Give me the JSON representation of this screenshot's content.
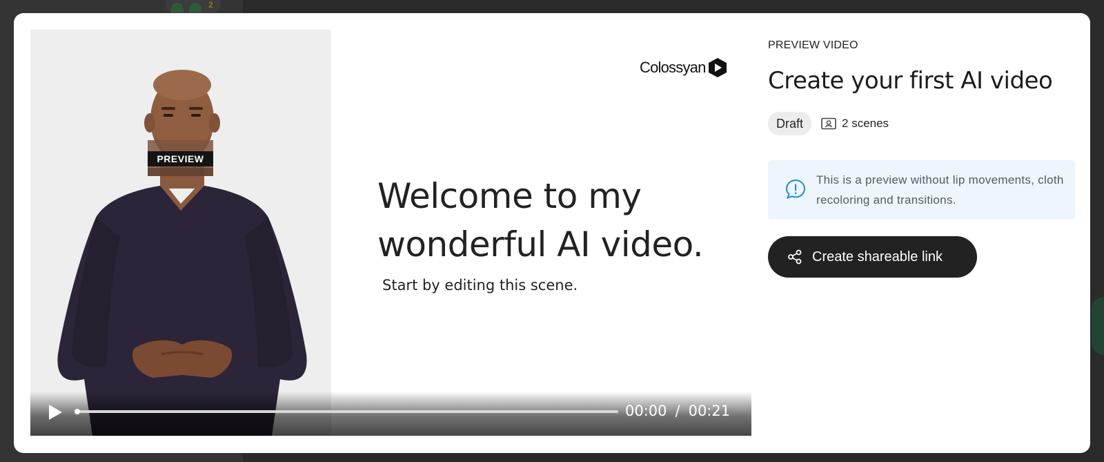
{
  "background": {
    "avatar_count": "2"
  },
  "player": {
    "preview_tag": "PREVIEW",
    "logo_text": "Colossyan",
    "slide_title": "Welcome to my wonderful AI video.",
    "slide_subtitle": "Start by editing this scene.",
    "current_time": "00:00",
    "time_separator": "/",
    "duration": "00:21",
    "progress": 0.0,
    "play_icon": "play-icon"
  },
  "info": {
    "eyebrow": "PREVIEW VIDEO",
    "title": "Create your first AI video",
    "status_badge": "Draft",
    "scenes_label": "2 scenes",
    "scenes_icon": "scenes-icon",
    "notice_text": "This is a preview without lip movements, cloth recoloring and transitions.",
    "notice_icon": "info-icon",
    "share_button": "Create shareable link",
    "share_icon": "share-icon"
  },
  "colors": {
    "accent_dark": "#222222",
    "notice_bg": "#eef5fd",
    "notice_icon": "#1e88e5",
    "avatar_bg": "#eeeeee"
  }
}
